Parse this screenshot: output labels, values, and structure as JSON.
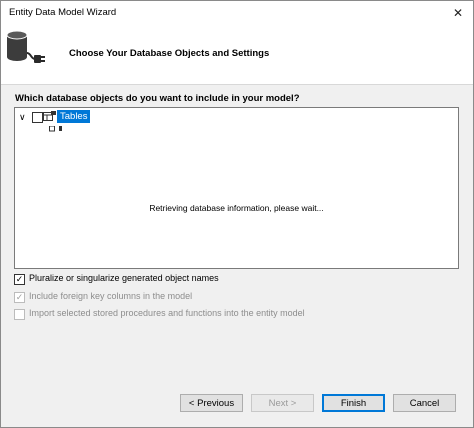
{
  "window": {
    "title": "Entity Data Model Wizard",
    "close_glyph": "✕"
  },
  "header": {
    "title": "Choose Your Database Objects and Settings",
    "icon": "database-plug-icon"
  },
  "main": {
    "question": "Which database objects do you want to include in your model?",
    "tree": {
      "expander_glyph": "∨",
      "root_label": "Tables",
      "root_checked": false,
      "loading_text": "Retrieving database information, please wait..."
    },
    "options": [
      {
        "label": "Pluralize or singularize generated object names",
        "checked": true,
        "enabled": true,
        "mark": "✓"
      },
      {
        "label": "Include foreign key columns in the model",
        "checked": true,
        "enabled": false,
        "mark": "✓"
      },
      {
        "label": "Import selected stored procedures and functions into the entity model",
        "checked": false,
        "enabled": false,
        "mark": ""
      }
    ]
  },
  "footer": {
    "previous_label": "< Previous",
    "next_label": "Next >",
    "finish_label": "Finish",
    "cancel_label": "Cancel"
  },
  "colors": {
    "selection": "#0078d7",
    "dialog_bg": "#f0f0f0"
  }
}
